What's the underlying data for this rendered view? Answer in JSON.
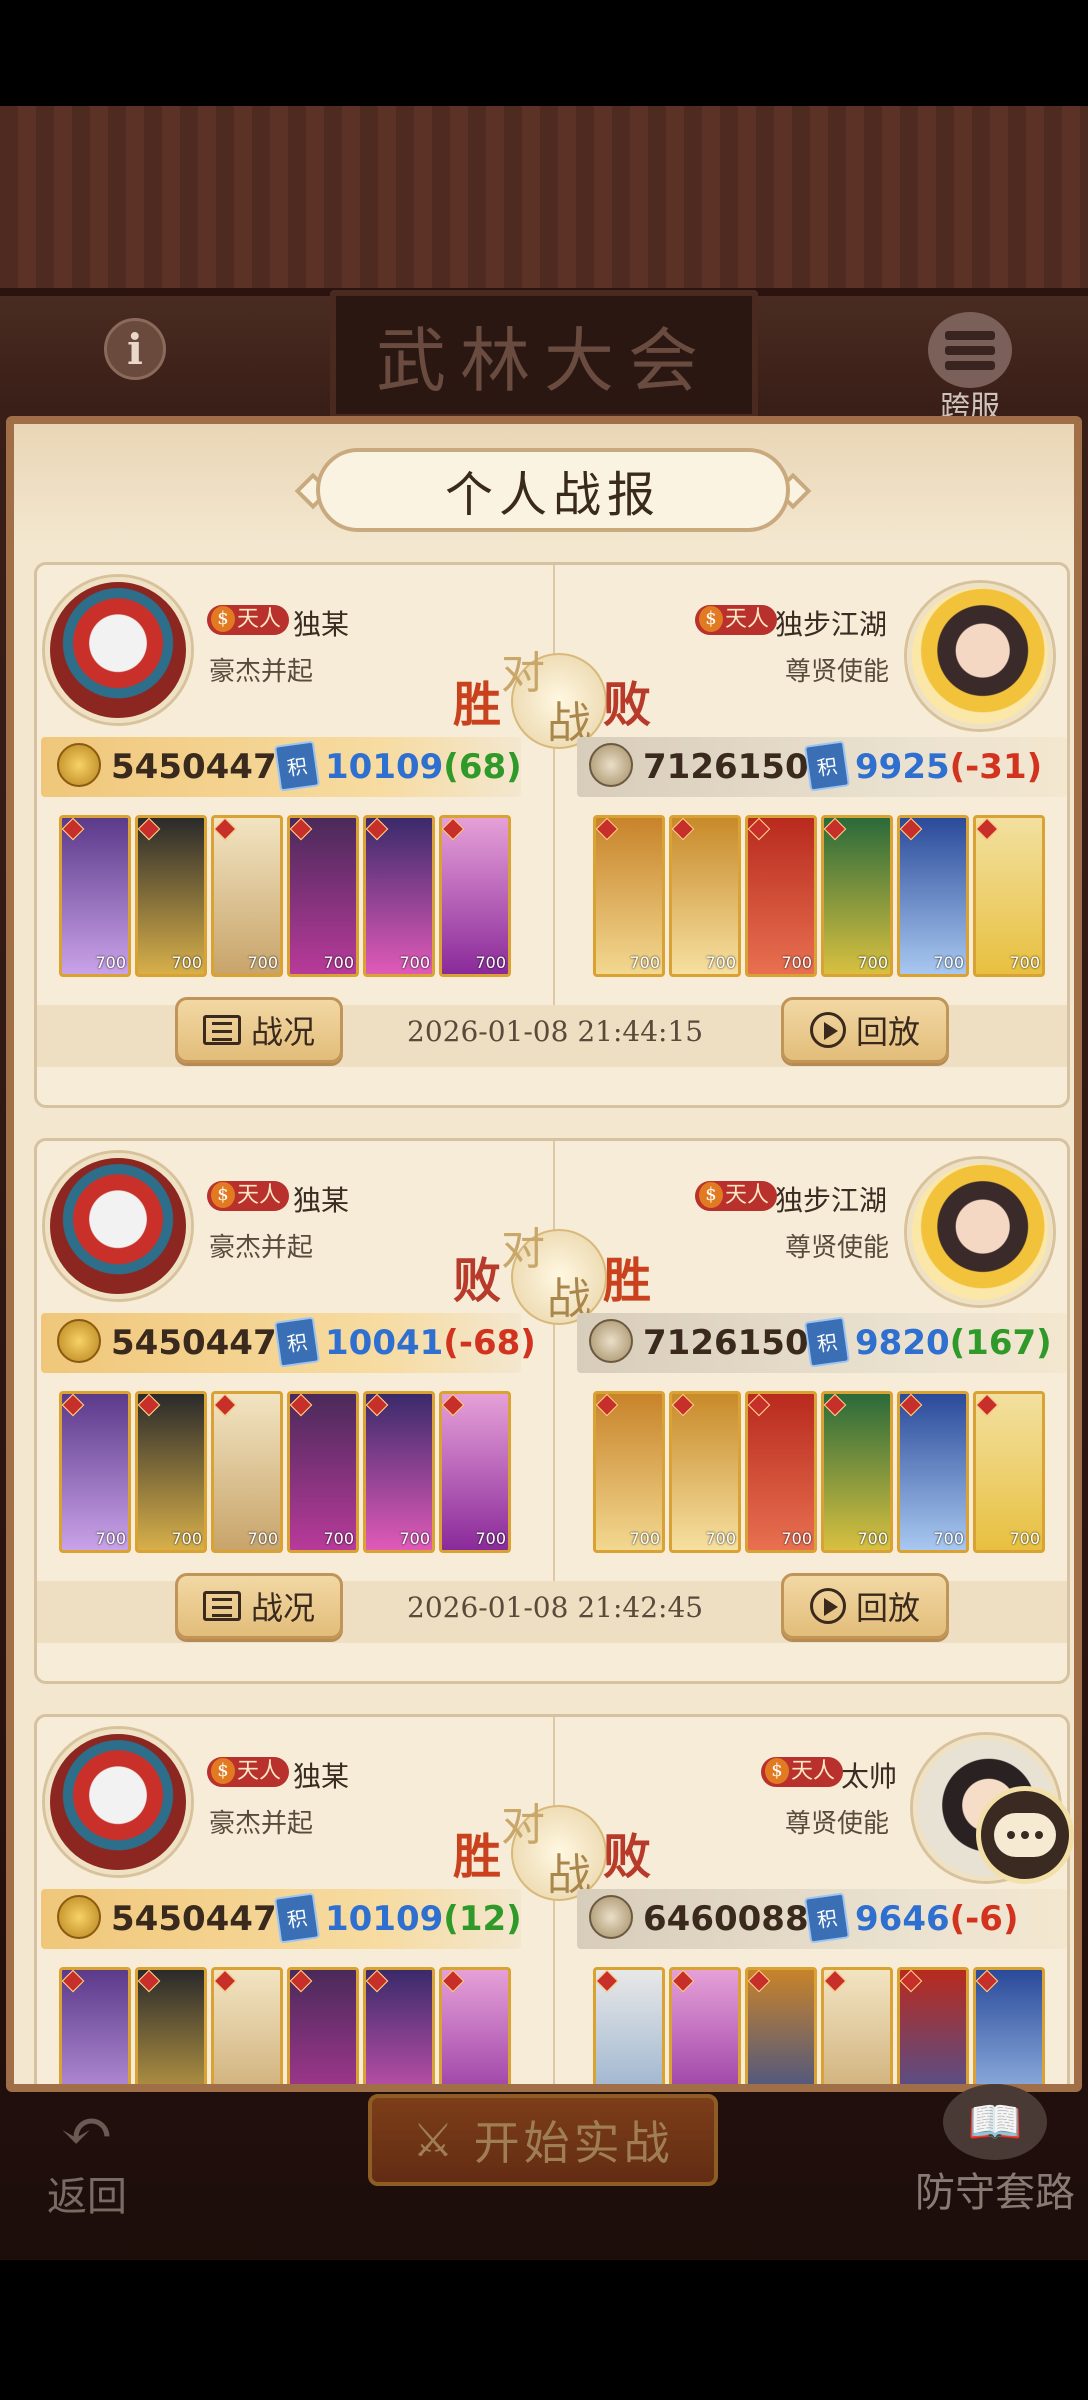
{
  "header": {
    "title": "武林大会",
    "info_icon": "info-icon",
    "cross_server_label": "跨服"
  },
  "panel": {
    "title": "个人战报"
  },
  "battles": [
    {
      "left": {
        "name": "独某",
        "rank": "天人",
        "title": "豪杰并起",
        "power": "5450447",
        "score": "10109",
        "delta": "(68)",
        "delta_sign": "pos",
        "result": "胜"
      },
      "right": {
        "name": "独步江湖",
        "rank": "天人",
        "title": "尊贤使能",
        "power": "7126150",
        "score": "9925",
        "delta": "(-31)",
        "delta_sign": "neg",
        "result": "败"
      },
      "time": "2026-01-08 21:44:15"
    },
    {
      "left": {
        "name": "独某",
        "rank": "天人",
        "title": "豪杰并起",
        "power": "5450447",
        "score": "10041",
        "delta": "(-68)",
        "delta_sign": "neg",
        "result": "败"
      },
      "right": {
        "name": "独步江湖",
        "rank": "天人",
        "title": "尊贤使能",
        "power": "7126150",
        "score": "9820",
        "delta": "(167)",
        "delta_sign": "pos",
        "result": "胜"
      },
      "time": "2026-01-08 21:42:45"
    },
    {
      "left": {
        "name": "独某",
        "rank": "天人",
        "title": "豪杰并起",
        "power": "5450447",
        "score": "10109",
        "delta": "(12)",
        "delta_sign": "pos",
        "result": "胜"
      },
      "right": {
        "name": "太帅",
        "rank": "天人",
        "title": "尊贤使能",
        "power": "6460088",
        "score": "9646",
        "delta": "(-6)",
        "delta_sign": "neg",
        "result": "败"
      },
      "time": ""
    }
  ],
  "vs_text": {
    "dui": "对",
    "zhan": "战"
  },
  "jifen_badge": "积",
  "hero_level": "700",
  "buttons": {
    "report": "战况",
    "replay": "回放",
    "back": "返回",
    "start": "开始实战",
    "defense": "防守套路"
  },
  "colors": {
    "win": "#c9421d",
    "score_blue": "#2e6fd0",
    "delta_positive": "#2f9a2a",
    "delta_negative": "#d2331f",
    "panel_bg": "#f3e7cf"
  }
}
